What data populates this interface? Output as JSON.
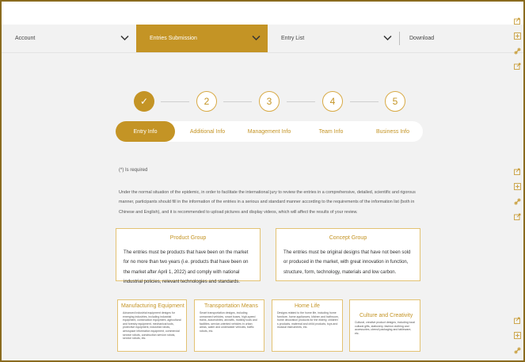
{
  "nav": {
    "items": [
      {
        "label": "Account"
      },
      {
        "label": "Entries Submission"
      },
      {
        "label": "Entry List"
      },
      {
        "label": "Download"
      }
    ]
  },
  "steps": {
    "done_symbol": "✓",
    "numbers": [
      "2",
      "3",
      "4",
      "5"
    ]
  },
  "tabs": [
    "Entry Info",
    "Additional Info",
    "Management Info",
    "Team Info",
    "Business Info"
  ],
  "required_note": "(*) Is required",
  "intro": "Under the normal situation of the epidemic, in order to facilitate the international jury to review the entries in a comprehensive, detailed, scientific and rigorous manner, participants should fill in the information of the entries in a serious and standard manner according to the requirements of the information list (both in Chinese and English), and it is recommended to upload pictures and display videos, which will affect the results of your review.",
  "groups": [
    {
      "title": "Product Group",
      "body": "The entries must be products that have been on the market for no more than two years (i.e. products that have been on the market after April 1, 2022) and comply with national industrial policies, relevant technologies and standards."
    },
    {
      "title": "Concept Group",
      "body": "The entries must be original designs that have not been sold or produced in the market, with great innovation in function, structure, form, technology, materials and low carbon."
    }
  ],
  "categories": [
    {
      "title": "Manufacturing Equipment",
      "desc": "Advanced industrial equipment designs for emerging industries, including industrial equipment, construction equipment, agricultural and forestry equipment, mechanical tools, protective equipment, industrial robots, aerospace information equipment, commercial service robots, construction service robots, service robots, etc."
    },
    {
      "title": "Transportation Means",
      "desc": "Smart transportation designs, including unmanned vehicles, smart buses, high-speed trains, automobiles, aircrafts, mobility tools and facilities, service-oriented vehicles in urban areas, water and underwater vehicles, traffic robots, etc."
    },
    {
      "title": "Home Life",
      "desc": "Designs related to the home life, including home furniture, home appliances, kitchen and bathroom, home decoration products for the elderly, children' s products, maternal and child products, toys and musical instruments, etc."
    },
    {
      "title": "Culture and Creativity",
      "desc": "Cultural, creative product designs, including local cultural gifts, stationery, fashion clothing and accessories, utensil packaging and tableware, etc."
    }
  ],
  "colors": {
    "accent": "#c49425",
    "border": "#e3c272",
    "frame": "#8a6b1f"
  }
}
